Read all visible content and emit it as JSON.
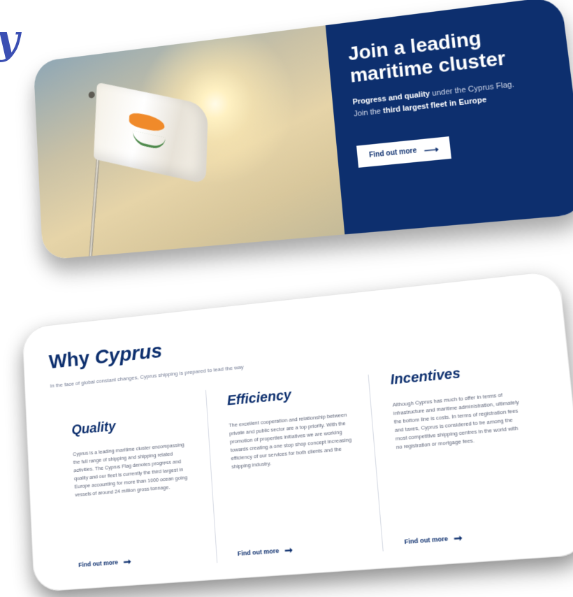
{
  "decor": {
    "handwritten_mark": "y"
  },
  "hero": {
    "title_light": "Join a",
    "title_bold": "leading maritime cluster",
    "text_bold_1": "Progress and quality",
    "text_1": "under the Cyprus Flag.",
    "text_2": "Join the",
    "text_bold_2": "third largest fleet in Europe",
    "button_label": "Find out more",
    "colors": {
      "panel": "#0d2f6e",
      "flag_map": "#f08a2a"
    }
  },
  "why": {
    "title_light": "Why",
    "title_bold": "Cyprus",
    "subtitle": "In the face of global constant changes, Cyprus shipping is prepared to lead the way",
    "columns": [
      {
        "heading": "Quality",
        "body": "Cyprus is a leading maritime cluster encompassing the full range of shipping and shipping related activities. The Cyprus Flag denotes progress and quality and our fleet is currently the third largest in Europe accounting for more than 1000 ocean going vessels of around 24 million gross tonnage.",
        "link": "Find out more"
      },
      {
        "heading": "Efficiency",
        "body": "The excellent cooperation and relationship between private and public sector are a top priority. With the promotion of properties initiatives we are working towards creating a one stop shop concept increasing efficiency of our services for both clients and the shipping industry.",
        "link": "Find out more"
      },
      {
        "heading": "Incentives",
        "body": "Although Cyprus has much to offer in terms of infrastructure and maritime administration, ultimately the bottom line is costs. In terms of registration fees and taxes, Cyprus is considered to be among the most competitive shipping centres in the world with no registration or mortgage fees.",
        "link": "Find out more"
      }
    ]
  }
}
